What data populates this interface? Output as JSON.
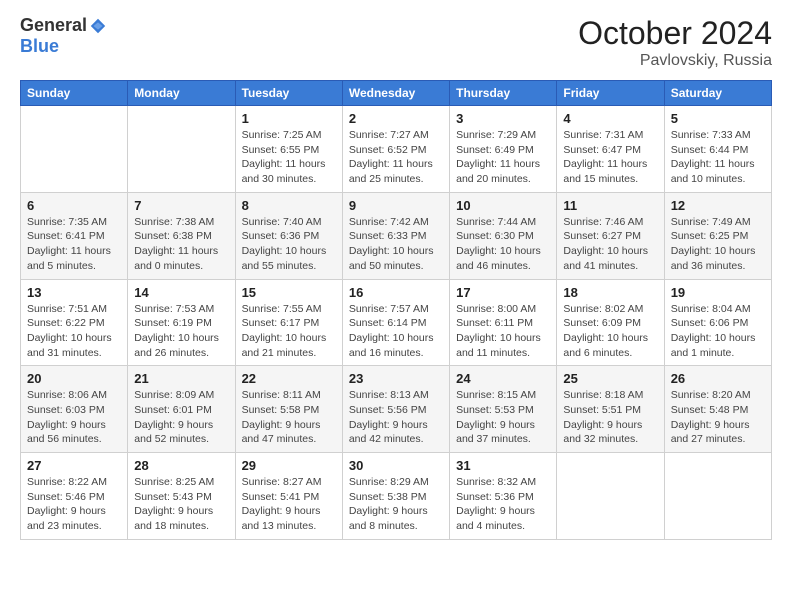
{
  "logo": {
    "general": "General",
    "blue": "Blue"
  },
  "header": {
    "month": "October 2024",
    "location": "Pavlovskiy, Russia"
  },
  "weekdays": [
    "Sunday",
    "Monday",
    "Tuesday",
    "Wednesday",
    "Thursday",
    "Friday",
    "Saturday"
  ],
  "weeks": [
    [
      {
        "day": "",
        "info": ""
      },
      {
        "day": "",
        "info": ""
      },
      {
        "day": "1",
        "info": "Sunrise: 7:25 AM\nSunset: 6:55 PM\nDaylight: 11 hours and 30 minutes."
      },
      {
        "day": "2",
        "info": "Sunrise: 7:27 AM\nSunset: 6:52 PM\nDaylight: 11 hours and 25 minutes."
      },
      {
        "day": "3",
        "info": "Sunrise: 7:29 AM\nSunset: 6:49 PM\nDaylight: 11 hours and 20 minutes."
      },
      {
        "day": "4",
        "info": "Sunrise: 7:31 AM\nSunset: 6:47 PM\nDaylight: 11 hours and 15 minutes."
      },
      {
        "day": "5",
        "info": "Sunrise: 7:33 AM\nSunset: 6:44 PM\nDaylight: 11 hours and 10 minutes."
      }
    ],
    [
      {
        "day": "6",
        "info": "Sunrise: 7:35 AM\nSunset: 6:41 PM\nDaylight: 11 hours and 5 minutes."
      },
      {
        "day": "7",
        "info": "Sunrise: 7:38 AM\nSunset: 6:38 PM\nDaylight: 11 hours and 0 minutes."
      },
      {
        "day": "8",
        "info": "Sunrise: 7:40 AM\nSunset: 6:36 PM\nDaylight: 10 hours and 55 minutes."
      },
      {
        "day": "9",
        "info": "Sunrise: 7:42 AM\nSunset: 6:33 PM\nDaylight: 10 hours and 50 minutes."
      },
      {
        "day": "10",
        "info": "Sunrise: 7:44 AM\nSunset: 6:30 PM\nDaylight: 10 hours and 46 minutes."
      },
      {
        "day": "11",
        "info": "Sunrise: 7:46 AM\nSunset: 6:27 PM\nDaylight: 10 hours and 41 minutes."
      },
      {
        "day": "12",
        "info": "Sunrise: 7:49 AM\nSunset: 6:25 PM\nDaylight: 10 hours and 36 minutes."
      }
    ],
    [
      {
        "day": "13",
        "info": "Sunrise: 7:51 AM\nSunset: 6:22 PM\nDaylight: 10 hours and 31 minutes."
      },
      {
        "day": "14",
        "info": "Sunrise: 7:53 AM\nSunset: 6:19 PM\nDaylight: 10 hours and 26 minutes."
      },
      {
        "day": "15",
        "info": "Sunrise: 7:55 AM\nSunset: 6:17 PM\nDaylight: 10 hours and 21 minutes."
      },
      {
        "day": "16",
        "info": "Sunrise: 7:57 AM\nSunset: 6:14 PM\nDaylight: 10 hours and 16 minutes."
      },
      {
        "day": "17",
        "info": "Sunrise: 8:00 AM\nSunset: 6:11 PM\nDaylight: 10 hours and 11 minutes."
      },
      {
        "day": "18",
        "info": "Sunrise: 8:02 AM\nSunset: 6:09 PM\nDaylight: 10 hours and 6 minutes."
      },
      {
        "day": "19",
        "info": "Sunrise: 8:04 AM\nSunset: 6:06 PM\nDaylight: 10 hours and 1 minute."
      }
    ],
    [
      {
        "day": "20",
        "info": "Sunrise: 8:06 AM\nSunset: 6:03 PM\nDaylight: 9 hours and 56 minutes."
      },
      {
        "day": "21",
        "info": "Sunrise: 8:09 AM\nSunset: 6:01 PM\nDaylight: 9 hours and 52 minutes."
      },
      {
        "day": "22",
        "info": "Sunrise: 8:11 AM\nSunset: 5:58 PM\nDaylight: 9 hours and 47 minutes."
      },
      {
        "day": "23",
        "info": "Sunrise: 8:13 AM\nSunset: 5:56 PM\nDaylight: 9 hours and 42 minutes."
      },
      {
        "day": "24",
        "info": "Sunrise: 8:15 AM\nSunset: 5:53 PM\nDaylight: 9 hours and 37 minutes."
      },
      {
        "day": "25",
        "info": "Sunrise: 8:18 AM\nSunset: 5:51 PM\nDaylight: 9 hours and 32 minutes."
      },
      {
        "day": "26",
        "info": "Sunrise: 8:20 AM\nSunset: 5:48 PM\nDaylight: 9 hours and 27 minutes."
      }
    ],
    [
      {
        "day": "27",
        "info": "Sunrise: 8:22 AM\nSunset: 5:46 PM\nDaylight: 9 hours and 23 minutes."
      },
      {
        "day": "28",
        "info": "Sunrise: 8:25 AM\nSunset: 5:43 PM\nDaylight: 9 hours and 18 minutes."
      },
      {
        "day": "29",
        "info": "Sunrise: 8:27 AM\nSunset: 5:41 PM\nDaylight: 9 hours and 13 minutes."
      },
      {
        "day": "30",
        "info": "Sunrise: 8:29 AM\nSunset: 5:38 PM\nDaylight: 9 hours and 8 minutes."
      },
      {
        "day": "31",
        "info": "Sunrise: 8:32 AM\nSunset: 5:36 PM\nDaylight: 9 hours and 4 minutes."
      },
      {
        "day": "",
        "info": ""
      },
      {
        "day": "",
        "info": ""
      }
    ]
  ]
}
